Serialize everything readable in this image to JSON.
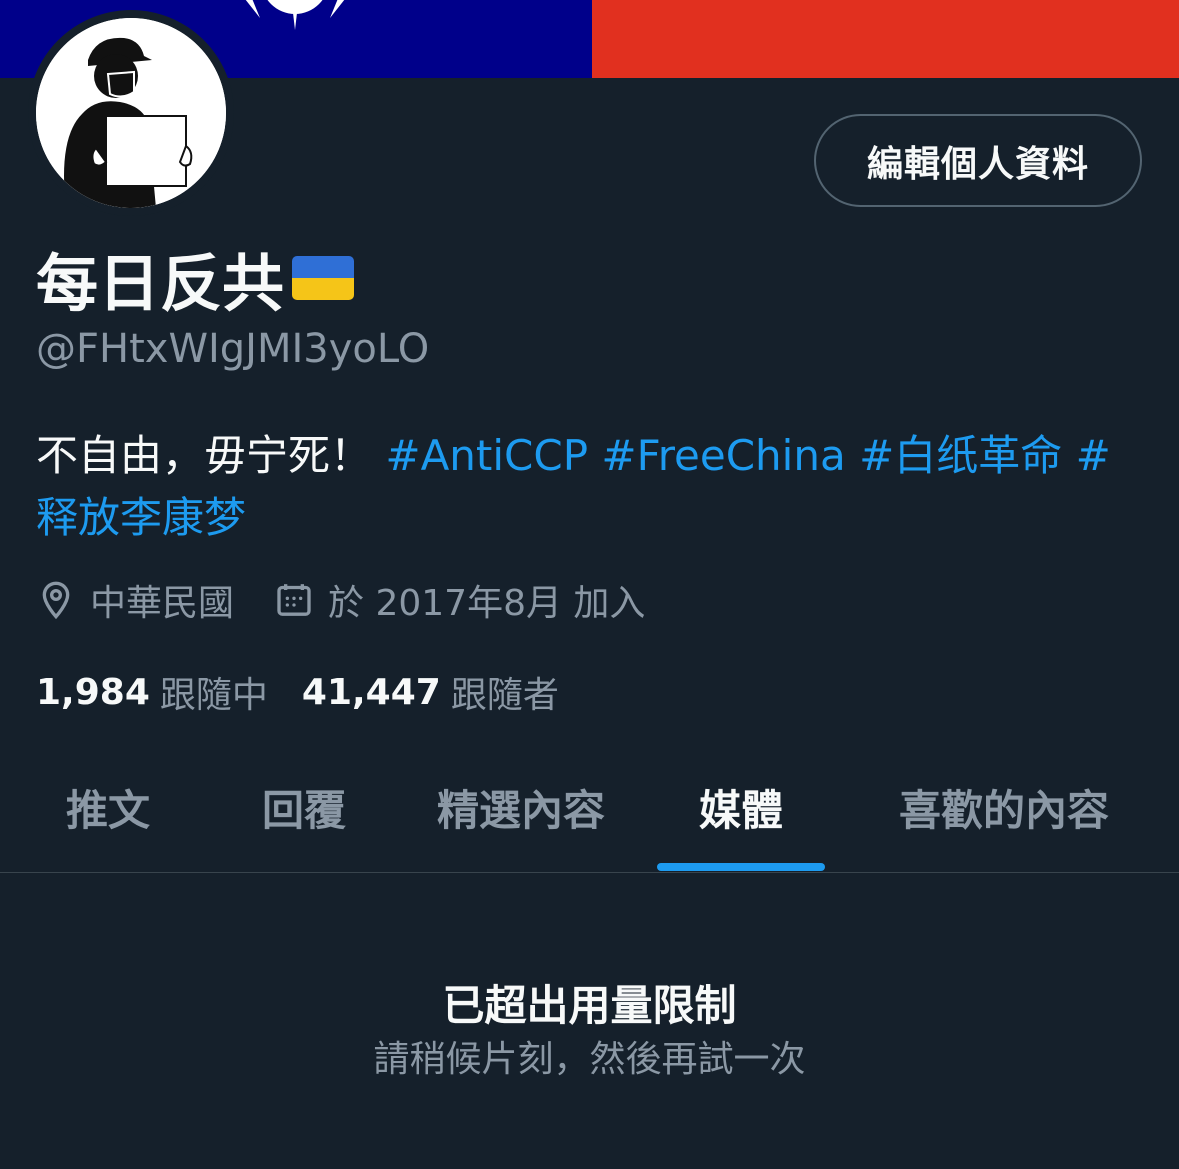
{
  "banner": {
    "colors": {
      "left": "#00008a",
      "right": "#e1301f",
      "sun": "#ffffff"
    }
  },
  "avatar": {
    "icon": "protester-holding-blank-paper"
  },
  "edit_profile_label": "編輯個人資料",
  "profile": {
    "display_name": "每日反共",
    "name_emoji": "ukraine-flag",
    "handle": "@FHtxWIgJMI3yoLO",
    "bio_text": "不自由，毋宁死！",
    "bio_hashtags": [
      "#AntiCCP",
      "#FreeChina",
      "#白纸革命",
      "#释放李康梦"
    ],
    "location": "中華民國",
    "joined": "於 2017年8月 加入",
    "following_count": "1,984",
    "following_label": "跟隨中",
    "followers_count": "41,447",
    "followers_label": "跟隨者"
  },
  "tabs": [
    {
      "label": "推文",
      "active": false
    },
    {
      "label": "回覆",
      "active": false
    },
    {
      "label": "精選內容",
      "active": false
    },
    {
      "label": "媒體",
      "active": true
    },
    {
      "label": "喜歡的內容",
      "active": false
    }
  ],
  "empty_state": {
    "title": "已超出用量限制",
    "subtitle": "請稍候片刻，然後再試一次"
  },
  "colors": {
    "background": "#15202b",
    "accent": "#1d9bf0",
    "secondary_text": "#8b98a5"
  }
}
